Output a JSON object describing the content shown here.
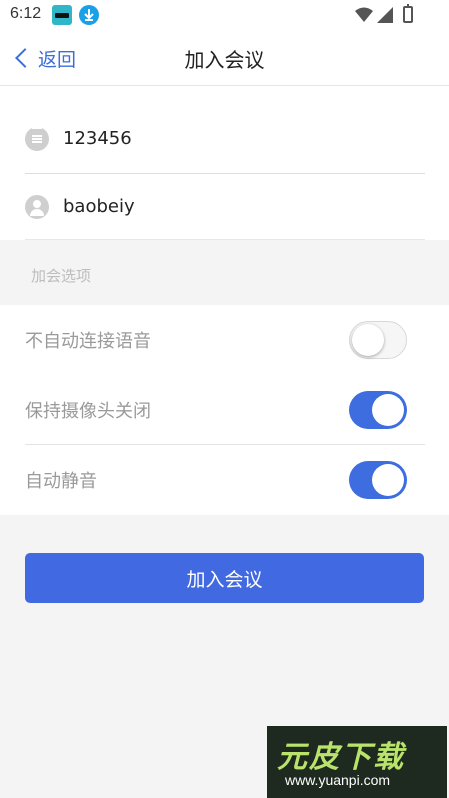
{
  "status_bar": {
    "time": "6:12"
  },
  "nav": {
    "back_label": "返回",
    "title": "加入会议"
  },
  "form": {
    "meeting_id": "123456",
    "username": "baobeiy"
  },
  "options": {
    "section_title": "加会选项",
    "items": [
      {
        "label": "不自动连接语音",
        "enabled": false
      },
      {
        "label": "保持摄像头关闭",
        "enabled": true
      },
      {
        "label": "自动静音",
        "enabled": true
      }
    ]
  },
  "join_button": {
    "label": "加入会议"
  },
  "watermark": {
    "title": "元皮下载",
    "url": "www.yuanpi.com"
  },
  "colors": {
    "accent": "#4169e1",
    "toggle_on": "#3e6de0",
    "toggle_off": "#f6f6f6"
  }
}
